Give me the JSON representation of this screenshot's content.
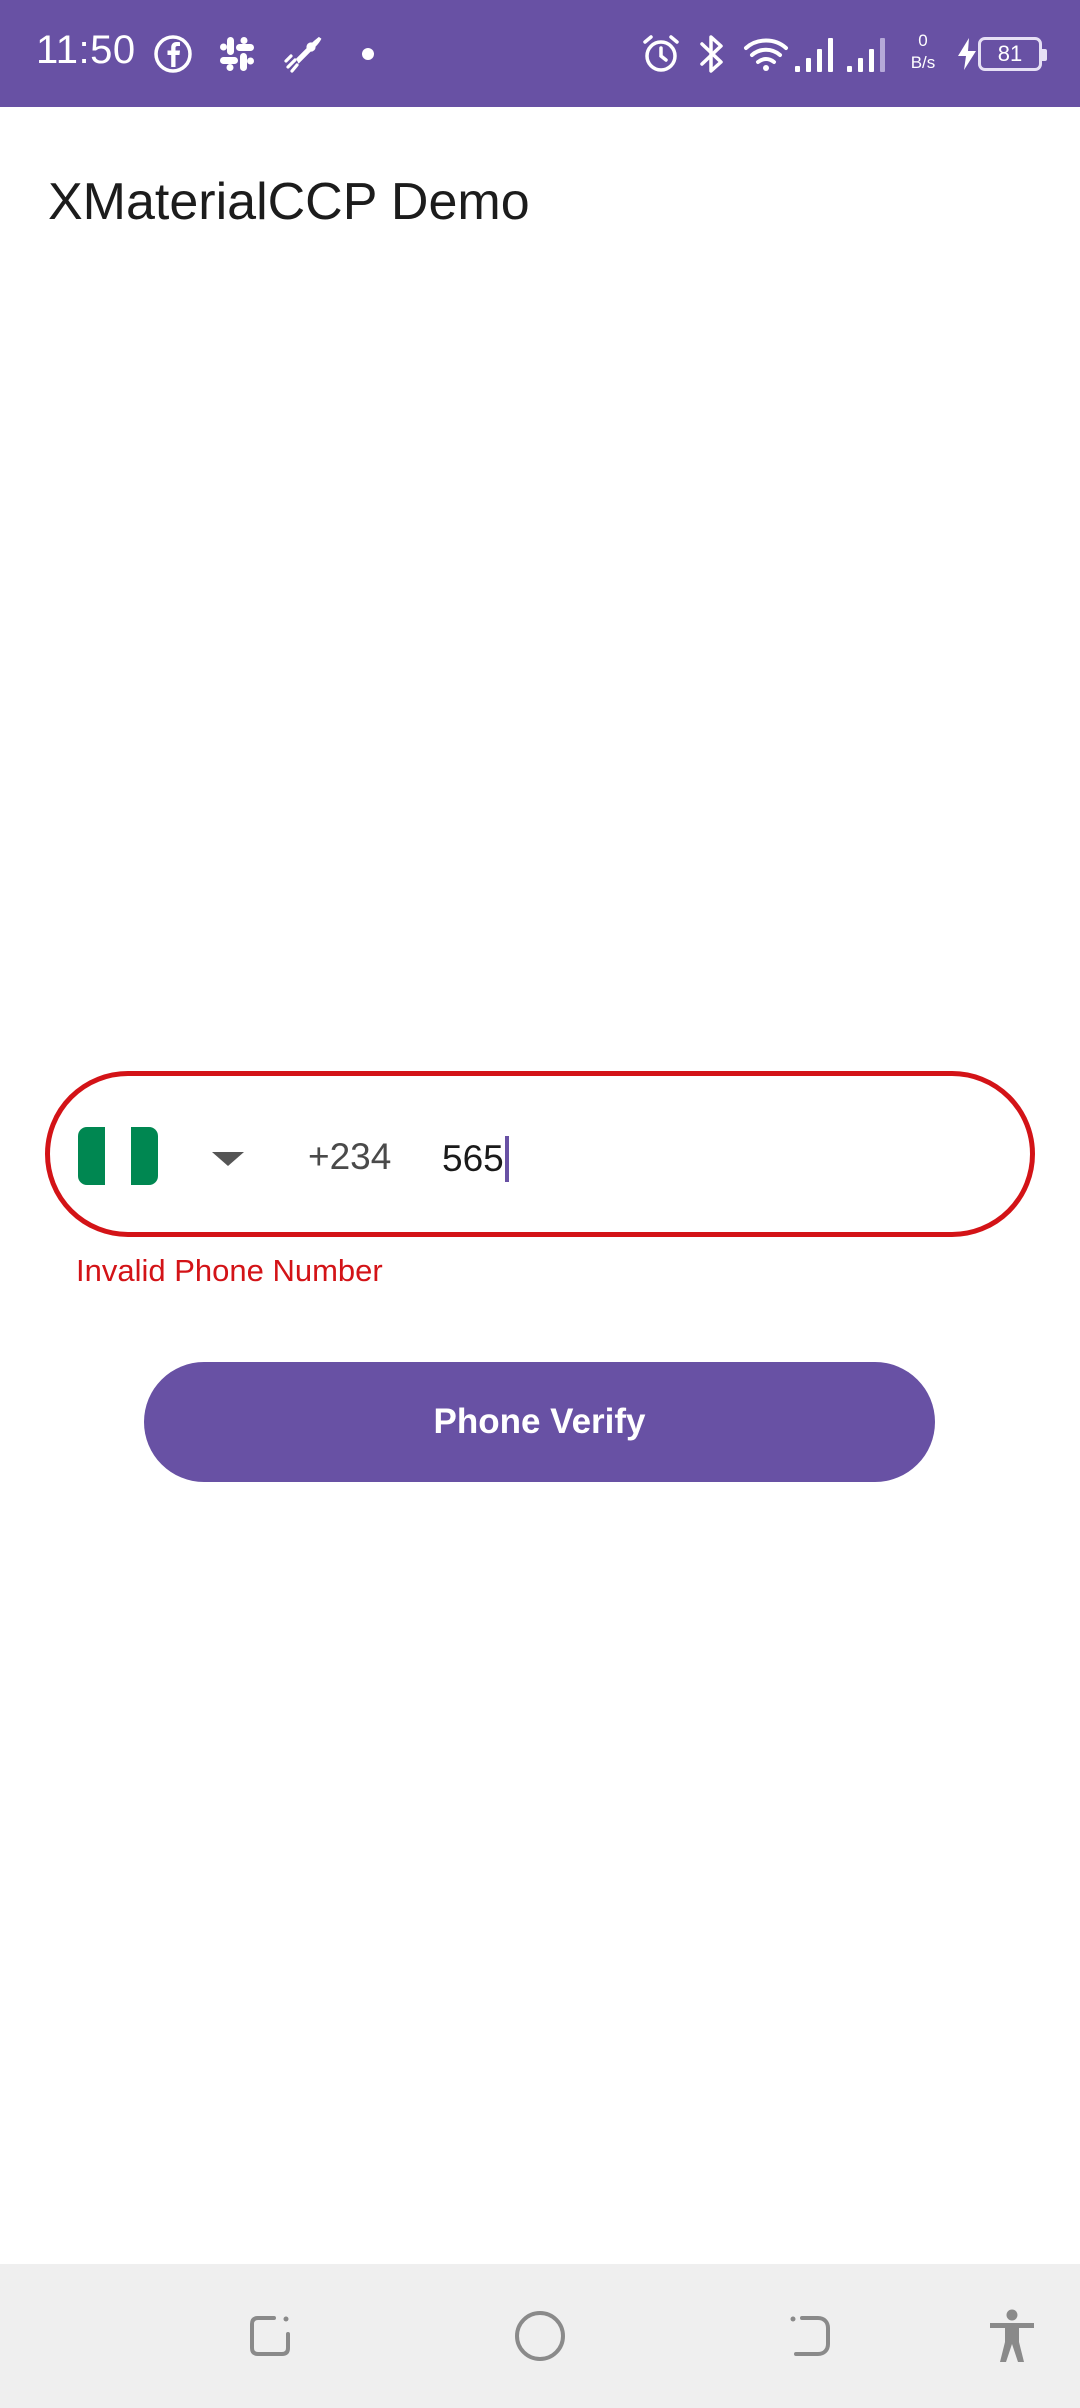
{
  "status_bar": {
    "time": "11:50",
    "net_speed_value": "0",
    "net_speed_unit": "B/s",
    "battery_level": "81",
    "background_color": "#6851a4",
    "notification_icons": [
      "facebook-icon",
      "slack-icon",
      "rocket-icon",
      "dot-icon"
    ],
    "system_icons": [
      "alarm-icon",
      "bluetooth-icon",
      "wifi-icon",
      "signal-icon",
      "signal-icon",
      "charging-icon",
      "battery-icon"
    ]
  },
  "app": {
    "title": "XMaterialCCP Demo"
  },
  "phone_input": {
    "country_flag": "nigeria-flag-icon",
    "flag_colors": [
      "#008751",
      "#ffffff",
      "#008751"
    ],
    "country_code": "+234",
    "value": "565",
    "border_color": "#d31317",
    "error": "Invalid Phone Number"
  },
  "actions": {
    "verify_label": "Phone Verify",
    "accent_color": "#6851a4"
  },
  "nav_bar": {
    "buttons": [
      "recents-icon",
      "home-icon",
      "back-icon",
      "accessibility-icon"
    ]
  }
}
